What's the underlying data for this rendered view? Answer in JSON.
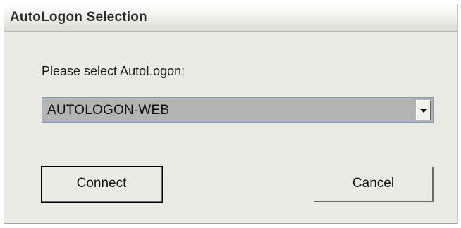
{
  "window": {
    "title": "AutoLogon Selection"
  },
  "form": {
    "prompt_label": "Please select AutoLogon:",
    "selected_value": "AUTOLOGON-WEB",
    "dropdown_icon": "chevron-down-icon"
  },
  "buttons": {
    "connect_label": "Connect",
    "cancel_label": "Cancel"
  },
  "colors": {
    "dialog_background": "#ebebe4",
    "selection_background": "#b4b4b4"
  }
}
